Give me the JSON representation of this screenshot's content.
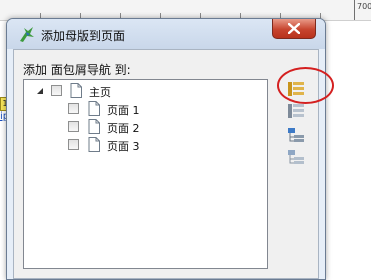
{
  "background": {
    "ruler_label": "700",
    "badge_text": "1",
    "link_fragment": "ip"
  },
  "dialog": {
    "title": "添加母版到页面",
    "prompt": "添加 面包屑导航 到:",
    "tree": [
      {
        "label": "主页",
        "level": 0,
        "expanded": true,
        "checked": false
      },
      {
        "label": "页面 1",
        "level": 1,
        "checked": false
      },
      {
        "label": "页面 2",
        "level": 1,
        "checked": false
      },
      {
        "label": "页面 3",
        "level": 1,
        "checked": false
      }
    ],
    "tools": [
      "check-all-icon",
      "uncheck-all-icon",
      "check-children-icon",
      "uncheck-children-icon"
    ],
    "colors": {
      "annotation": "#d42020",
      "close_button": "#c7452f",
      "title_bar": "#c9d7ea"
    }
  }
}
